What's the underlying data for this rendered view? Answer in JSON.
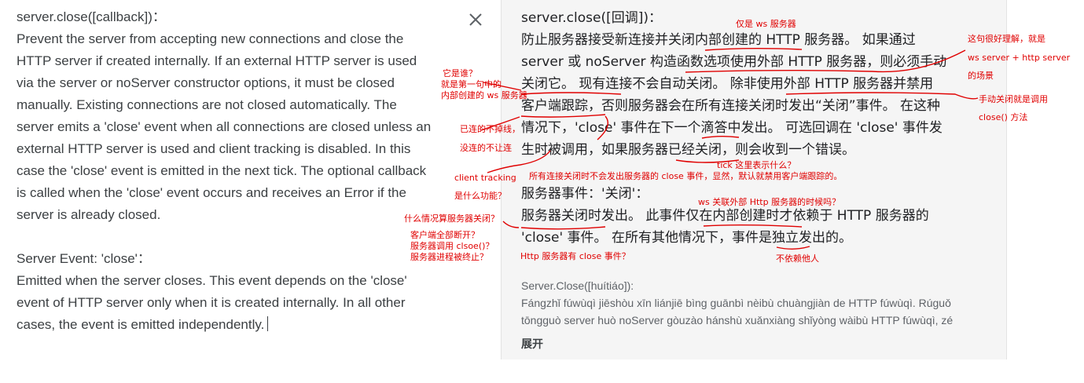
{
  "source": {
    "text": "server.close([callback])：\nPrevent the server from accepting new connections and close the\nHTTP server if created internally. If an external HTTP server is used\nvia the server or noServer constructor options, it must be closed\nmanually. Existing connections are not closed automatically. The\nserver emits a 'close' event when all connections are closed unless an\nexternal HTTP server is used and client tracking is disabled. In this\ncase the 'close' event is emitted in the next tick. The optional callback\nis called when the 'close' event occurs and receives an Error if the\nserver is already closed.\n\nServer Event: 'close'：\nEmitted when the server closes. This event depends on the 'close'\nevent of HTTP server only when it is created internally. In all other\ncases, the event is emitted independently.",
    "clear_icon": "close-icon"
  },
  "translation": {
    "text": "server.close([回调])：\n防止服务器接受新连接并关闭内部创建的 HTTP 服务器。 如果通过\nserver 或 noServer 构造函数选项使用外部 HTTP 服务器，则必须手动\n关闭它。 现有连接不会自动关闭。 除非使用外部 HTTP 服务器并禁用\n客户端跟踪，否则服务器会在所有连接关闭时发出“关闭”事件。 在这种\n情况下，'close' 事件在下一个滴答中发出。 可选回调在 'close' 事件发\n生时被调用，如果服务器已经关闭，则会收到一个错误。\n\n服务器事件：'关闭'：\n服务器关闭时发出。 此事件仅在内部创建时才依赖于 HTTP 服务器的\n'close' 事件。 在所有其他情况下，事件是独立发出的。",
    "transliteration": "Server.Close([huítiáo]):\nFángzhǐ fúwùqì jiēshòu xīn liánjiē bìng guānbì nèibù chuàngjiàn de HTTP fúwùqì. Rúguǒ\ntōngguò server huò noServer gòuzào hánshù xuǎnxiàng shǐyòng wàibù HTTP fúwùqì, zé",
    "expand_label": "展开"
  },
  "annotations": {
    "a1": "仅是 ws 服务器",
    "a2": "这句很好理解，就是",
    "a3": "ws server + http server",
    "a4": "的场景",
    "a5": "它是谁？",
    "a6": "就是第一句中的",
    "a7": "内部创建的 ws 服务器",
    "a8": "手动关闭就是调用",
    "a9": "close() 方法",
    "a10": "已连的不掉线，",
    "a11": "没连的不让连",
    "a12": "tick 这里表示什么？",
    "a13": "client tracking",
    "a14": "所有连接关闭时不会发出服务器的 close 事件，显然，默认就禁用客户端跟踪的。",
    "a15": "是什么功能？",
    "a16": "ws 关联外部 Http 服务器的时候吗？",
    "a17": "什么情况算服务器关闭？",
    "a18": "客户端全部断开？",
    "a19": "服务器调用 clsoe()？",
    "a20": "服务器进程被终止？",
    "a21": "Http 服务器有 close 事件？",
    "a22": "不依赖他人"
  },
  "colors": {
    "annotation": "#e00000",
    "panel": "#f5f5f5"
  }
}
